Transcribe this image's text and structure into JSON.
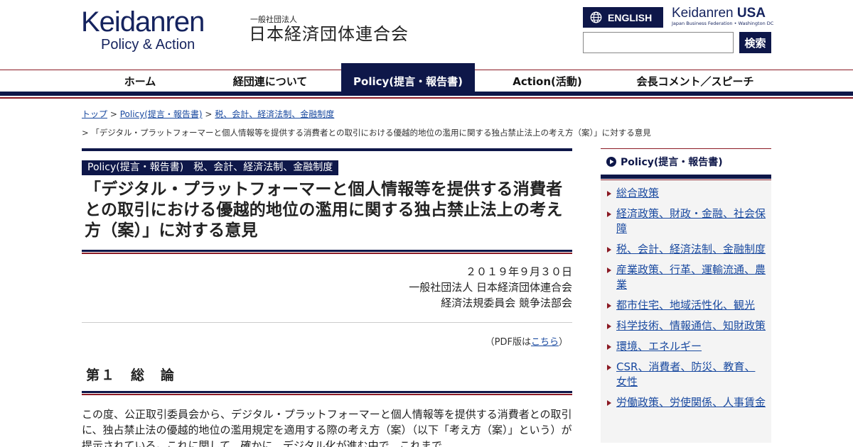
{
  "header": {
    "logo_main": "Keidanren",
    "logo_sub": "Policy & Action",
    "org_small": "一般社団法人",
    "org_name": "日本経済団体連合会",
    "english_label": "ENGLISH",
    "usa_main_a": "Keidanren",
    "usa_main_b": "USA",
    "usa_sub": "Japan Business Federation • Washington DC",
    "search_placeholder": "",
    "search_button": "検索"
  },
  "nav": {
    "items": [
      {
        "label": "ホーム"
      },
      {
        "label": "経団連について"
      },
      {
        "label": "Policy(提言・報告書)"
      },
      {
        "label": "Action(活動)"
      },
      {
        "label": "会長コメント／スピーチ"
      }
    ]
  },
  "breadcrumb": {
    "top": "トップ",
    "sep": " > ",
    "policy": "Policy(提言・報告書)",
    "tax": "税、会計、経済法制、金融制度",
    "current": "> 「デジタル・プラットフォーマーと個人情報等を提供する消費者との取引における優越的地位の濫用に関する独占禁止法上の考え方（案）」に対する意見"
  },
  "article": {
    "category": "Policy(提言・報告書)　税、会計、経済法制、金融制度",
    "title": "「デジタル・プラットフォーマーと個人情報等を提供する消費者との取引における優越的地位の濫用に関する独占禁止法上の考え方（案）」に対する意見",
    "date": "２０１９年９月３０日",
    "org": "一般社団法人 日本経済団体連合会",
    "committee": "経済法規委員会 競争法部会",
    "pdf_prefix": "（PDF版は",
    "pdf_link": "こちら",
    "pdf_suffix": "）",
    "section_heading": "第１　総　論",
    "body": "この度、公正取引委員会から、デジタル・プラットフォーマーと個人情報等を提供する消費者との取引に、独占禁止法の優越的地位の濫用規定を適用する際の考え方（案）（以下「考え方（案）」という）が提示されている。これに関して、確かに、デジタル化が進む中で、これまで"
  },
  "sidebar": {
    "heading": "Policy(提言・報告書)",
    "items": [
      {
        "label": "総合政策"
      },
      {
        "label": "経済政策、財政・金融、社会保障"
      },
      {
        "label": "税、会計、経済法制、金融制度"
      },
      {
        "label": "産業政策、行革、運輸流通、農業"
      },
      {
        "label": "都市住宅、地域活性化、観光"
      },
      {
        "label": "科学技術、情報通信、知財政策"
      },
      {
        "label": "環境、エネルギー"
      },
      {
        "label": "CSR、消費者、防災、教育、女性"
      },
      {
        "label": "労働政策、労使関係、人事賃金"
      }
    ]
  },
  "colors": {
    "navy": "#0e1749",
    "crimson": "#8b1a24",
    "link": "#1a4aa0"
  }
}
